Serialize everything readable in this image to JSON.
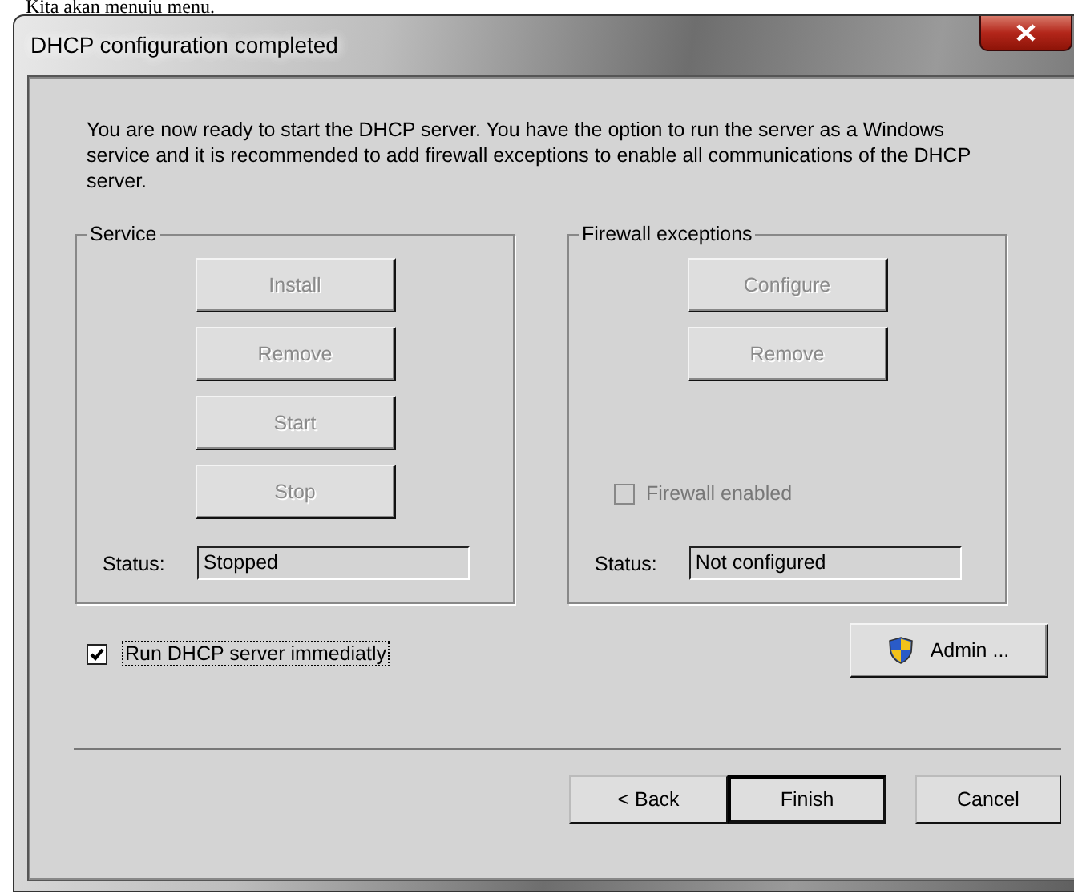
{
  "caption": "Kita akan menuju menu.",
  "window": {
    "title": "DHCP configuration completed"
  },
  "intro": "You are now ready to start the DHCP server. You have the option to run the server as a Windows service and it is recommended to add firewall exceptions to enable all communications of the DHCP server.",
  "groups": [
    {
      "title": "Service",
      "buttons": [
        {
          "label": "Install",
          "disabled": true
        },
        {
          "label": "Remove",
          "disabled": true
        },
        {
          "label": "Start",
          "disabled": true
        },
        {
          "label": "Stop",
          "disabled": true
        }
      ],
      "status_label": "Status:",
      "status_value": "Stopped"
    },
    {
      "title": "Firewall exceptions",
      "buttons": [
        {
          "label": "Configure",
          "disabled": true
        },
        {
          "label": "Remove",
          "disabled": true
        }
      ],
      "checkbox": {
        "label": "Firewall enabled",
        "checked": false,
        "disabled": true
      },
      "status_label": "Status:",
      "status_value": "Not configured"
    }
  ],
  "run_checkbox": {
    "label": "Run DHCP server immediatly",
    "checked": true
  },
  "admin_button": {
    "label": "Admin ..."
  },
  "footer_buttons": [
    {
      "label": "< Back",
      "default": false
    },
    {
      "label": "Finish",
      "default": true
    },
    {
      "label": "Cancel",
      "default": false
    }
  ]
}
